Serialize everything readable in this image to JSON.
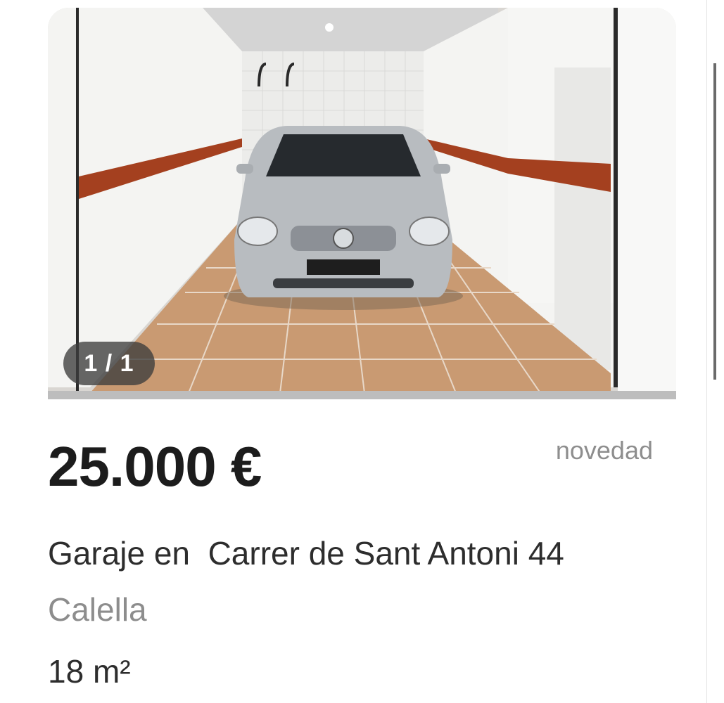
{
  "photo": {
    "counter": "1 / 1"
  },
  "listing": {
    "price": "25.000 €",
    "badge": "novedad",
    "title": "Garaje en  Carrer de Sant Antoni 44",
    "city": "Calella",
    "area": "18 m²"
  },
  "colors": {
    "stripe": "#a4401f",
    "floor": "#c99a72",
    "wall": "#f3f3f1",
    "price_text": "#1c1c1c",
    "muted_text": "#8d8d8d"
  }
}
